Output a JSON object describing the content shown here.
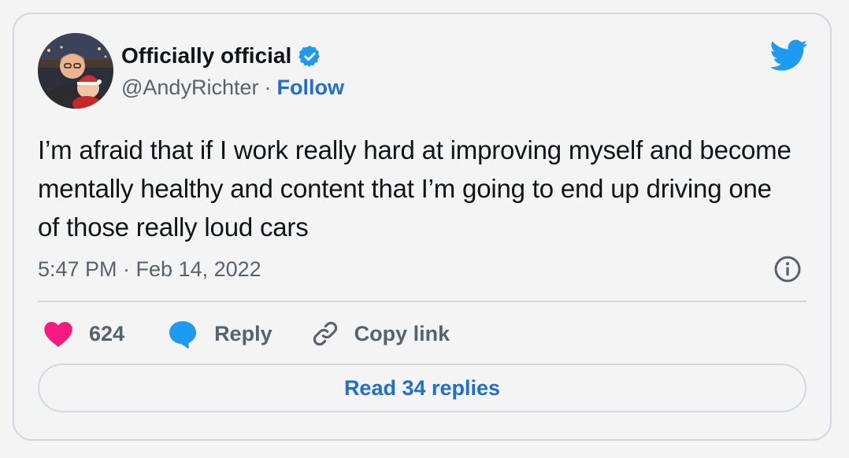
{
  "author": {
    "display_name": "Officially official",
    "handle": "@AndyRichter",
    "separator": "·",
    "follow_label": "Follow",
    "verified": true
  },
  "tweet": {
    "text": "I’m afraid that if I work really hard at improving myself and become mentally healthy and content that I’m going to end up driving one of those really loud cars",
    "timestamp": "5:47 PM · Feb 14, 2022"
  },
  "actions": {
    "like_count": "624",
    "reply_label": "Reply",
    "copy_link_label": "Copy link"
  },
  "read_replies_label": "Read 34 replies",
  "icons": {
    "brand": "twitter-bird-icon",
    "verified": "verified-badge-icon",
    "info": "info-icon",
    "like": "heart-icon",
    "reply": "speech-bubble-icon",
    "copy": "link-icon"
  },
  "colors": {
    "background": "#f4f4f5",
    "border": "#cfd9de",
    "text_primary": "#0f1419",
    "text_secondary": "#536471",
    "link_blue": "#1d6fd1",
    "twitter_blue": "#1d9bf0",
    "like_pink": "#f91880"
  }
}
